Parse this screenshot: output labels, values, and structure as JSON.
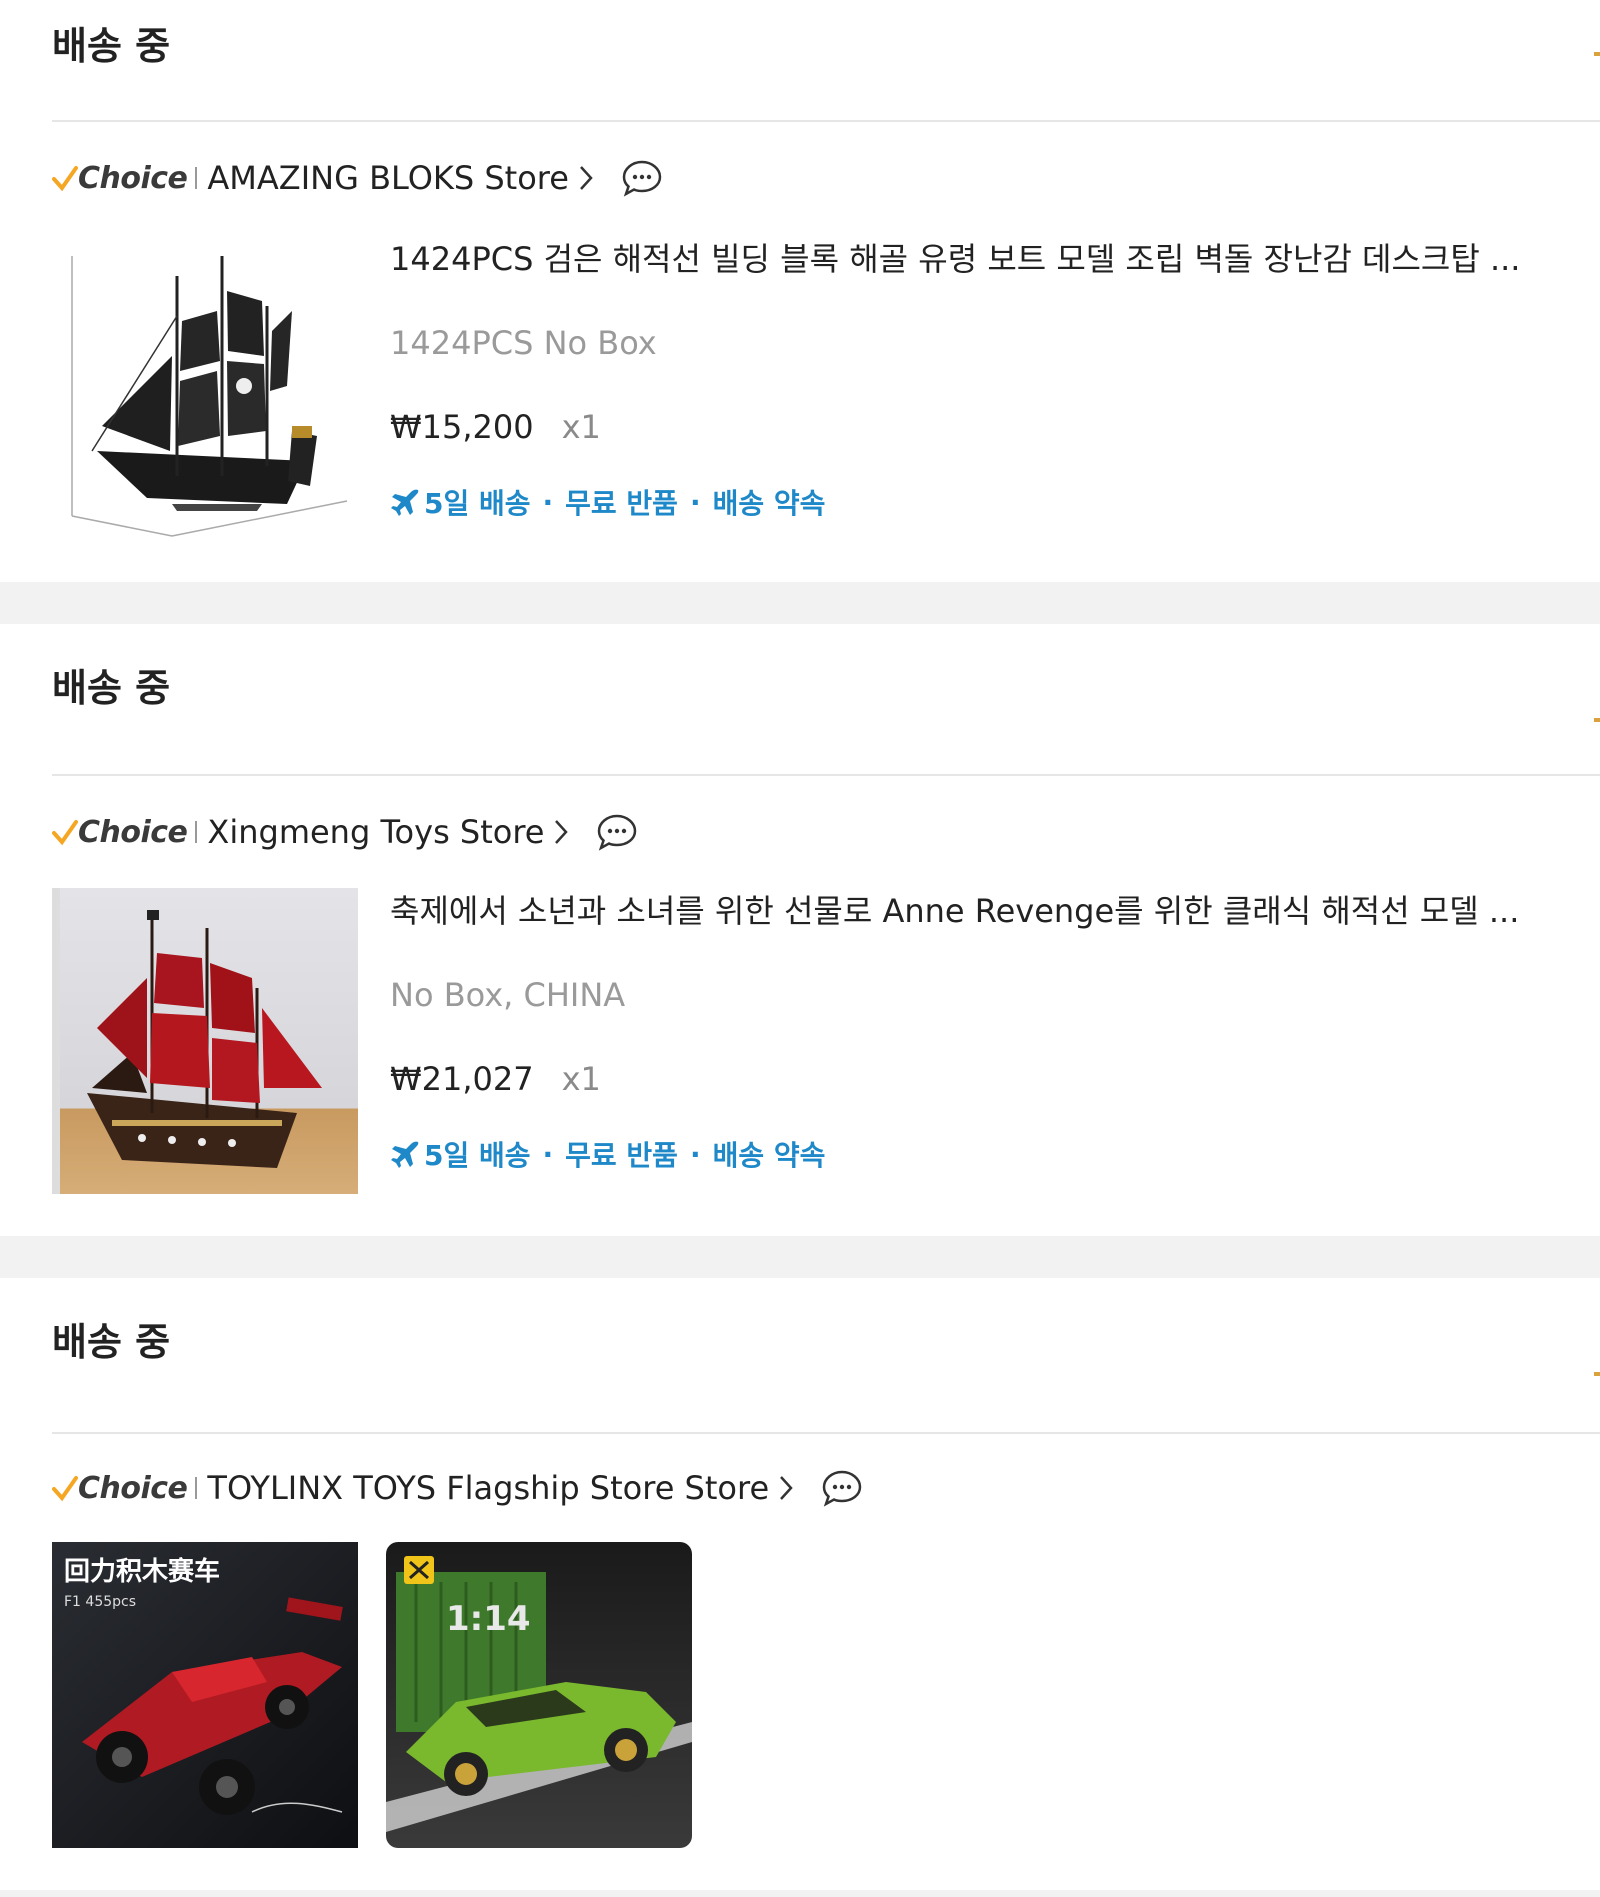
{
  "orders": [
    {
      "status": "배송 중",
      "choice_label": "Choice",
      "store": "AMAZING BLOKS Store",
      "item": {
        "title": "1424PCS 검은 해적선 빌딩 블록 해골 유령 보트 모델 조립 벽돌 장난감 데스크탑 ...",
        "variant": "1424PCS No Box",
        "price": "₩15,200",
        "qty": "x1",
        "shipping": [
          "5일 배송",
          "무료 반품",
          "배송 약속"
        ]
      }
    },
    {
      "status": "배송 중",
      "choice_label": "Choice",
      "store": "Xingmeng Toys Store",
      "item": {
        "title": "축제에서 소년과 소녀를 위한 선물로 Anne Revenge를 위한 클래식 해적선 모델 ...",
        "variant": "No Box, CHINA",
        "price": "₩21,027",
        "qty": "x1",
        "shipping": [
          "5일 배송",
          "무료 반품",
          "배송 약속"
        ]
      }
    },
    {
      "status": "배송 중",
      "choice_label": "Choice",
      "store": "TOYLINX TOYS Flagship Store Store",
      "thumbs": [
        {
          "overlay_title": "回力积木赛车",
          "overlay_sub": "F1 455pcs"
        },
        {
          "overlay_scale": "1:14"
        }
      ]
    }
  ],
  "separator": "·",
  "colors": {
    "shipping": "#1e88c8",
    "choice_check": "#f5a623",
    "muted": "#9a9a9a"
  },
  "icons": [
    "check-icon",
    "chevron-right-icon",
    "chat-bubble-icon",
    "airplane-icon"
  ]
}
